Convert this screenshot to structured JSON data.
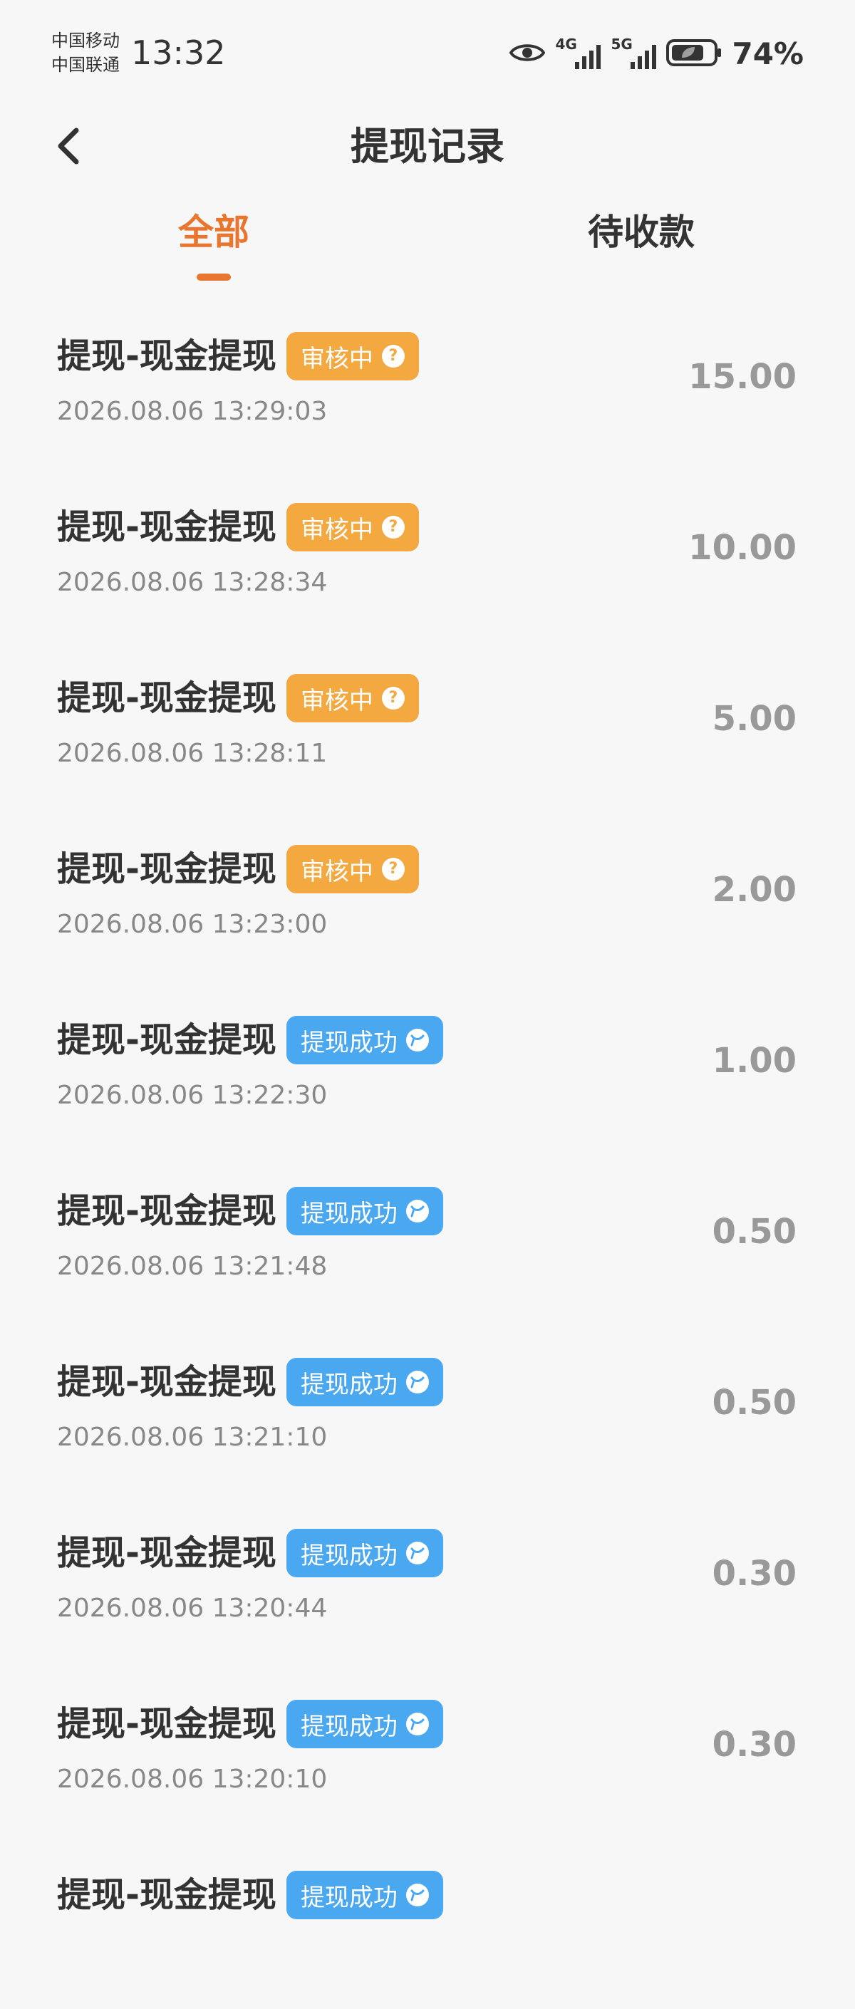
{
  "status_bar": {
    "carrier_1": "中国移动",
    "carrier_2": "中国联通",
    "time": "13:32",
    "signal_1_label": "4G",
    "signal_2_label": "5G",
    "battery": "74%"
  },
  "header": {
    "title": "提现记录"
  },
  "tabs": [
    {
      "label": "全部",
      "active": true
    },
    {
      "label": "待收款",
      "active": false
    }
  ],
  "records": [
    {
      "title": "提现-现金提现",
      "status": "审核中",
      "status_type": "pending",
      "time": "2026.08.06 13:29:03",
      "amount": "15.00"
    },
    {
      "title": "提现-现金提现",
      "status": "审核中",
      "status_type": "pending",
      "time": "2026.08.06 13:28:34",
      "amount": "10.00"
    },
    {
      "title": "提现-现金提现",
      "status": "审核中",
      "status_type": "pending",
      "time": "2026.08.06 13:28:11",
      "amount": "5.00"
    },
    {
      "title": "提现-现金提现",
      "status": "审核中",
      "status_type": "pending",
      "time": "2026.08.06 13:23:00",
      "amount": "2.00"
    },
    {
      "title": "提现-现金提现",
      "status": "提现成功",
      "status_type": "success",
      "time": "2026.08.06 13:22:30",
      "amount": "1.00"
    },
    {
      "title": "提现-现金提现",
      "status": "提现成功",
      "status_type": "success",
      "time": "2026.08.06 13:21:48",
      "amount": "0.50"
    },
    {
      "title": "提现-现金提现",
      "status": "提现成功",
      "status_type": "success",
      "time": "2026.08.06 13:21:10",
      "amount": "0.50"
    },
    {
      "title": "提现-现金提现",
      "status": "提现成功",
      "status_type": "success",
      "time": "2026.08.06 13:20:44",
      "amount": "0.30"
    },
    {
      "title": "提现-现金提现",
      "status": "提现成功",
      "status_type": "success",
      "time": "2026.08.06 13:20:10",
      "amount": "0.30"
    },
    {
      "title": "提现-现金提现",
      "status": "提现成功",
      "status_type": "success",
      "time": "",
      "amount": ""
    }
  ],
  "colors": {
    "accent": "#e8762f",
    "pending_badge": "#f4a840",
    "success_badge": "#4aa8f0",
    "background": "#f7f7f7"
  },
  "icons": {
    "back": "chevron-left-icon",
    "pending": "question-circle-icon",
    "success": "chat-bubble-icon",
    "visibility": "eye-icon",
    "battery": "battery-icon"
  }
}
